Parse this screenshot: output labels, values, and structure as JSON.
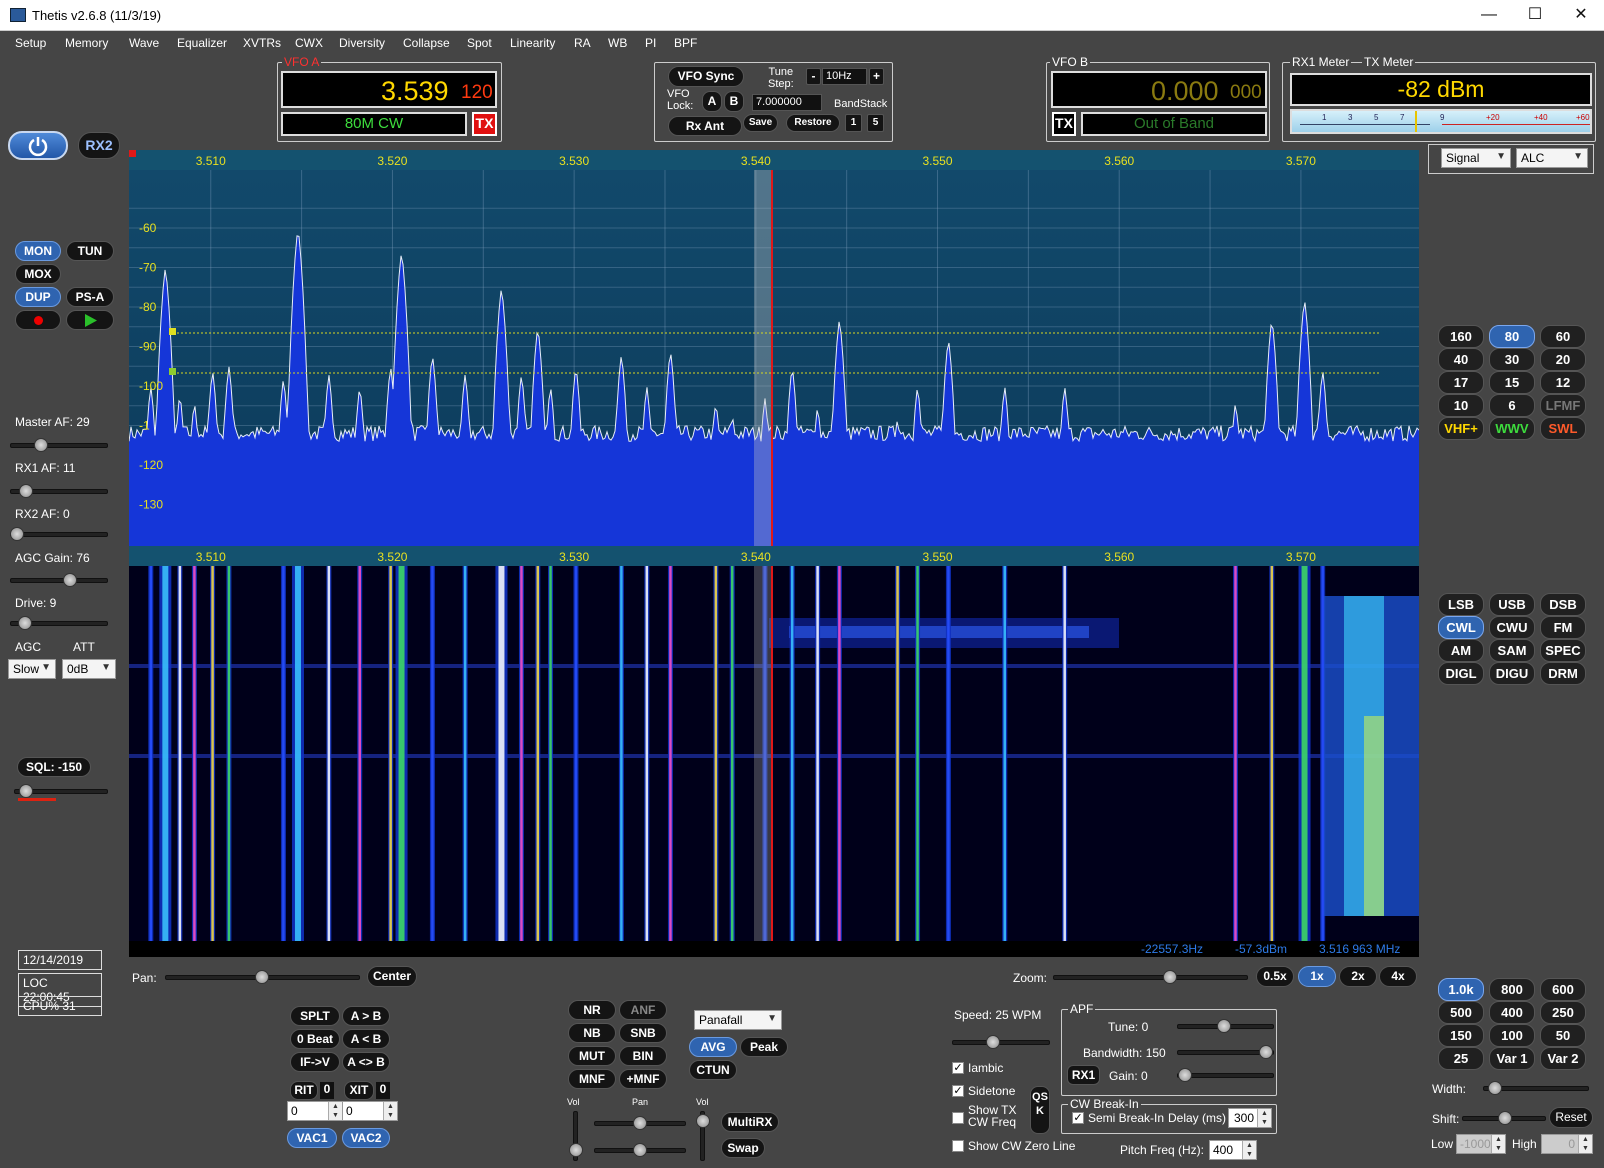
{
  "window": {
    "title": "Thetis v2.6.8 (11/3/19)",
    "min": "—",
    "max": "☐",
    "close": "✕"
  },
  "menu": [
    "Setup",
    "Memory",
    "Wave",
    "Equalizer",
    "XVTRs",
    "CWX",
    "Diversity",
    "Collapse",
    "Spot",
    "Linearity",
    "RA",
    "WB",
    "PI",
    "BPF"
  ],
  "vfo_a": {
    "caption": "VFO A",
    "freq": "3.539",
    "freq_sub": "120",
    "band_mode": "80M CW",
    "tx": "TX"
  },
  "vfo_center": {
    "sync": "VFO Sync",
    "tune_step_label": "Tune\nStep:",
    "tune_step_value": "10Hz",
    "minus": "-",
    "plus": "+",
    "lock_label": "VFO\nLock:",
    "a": "A",
    "b": "B",
    "bandstack_value": "7.000000",
    "bandstack_label": "BandStack",
    "rx_ant": "Rx Ant",
    "save": "Save",
    "restore": "Restore",
    "one": "1",
    "five": "5"
  },
  "vfo_b": {
    "caption": "VFO B",
    "freq": "0.000",
    "freq_sub": "000",
    "tx": "TX",
    "band_label": "Out of Band"
  },
  "meter": {
    "rx1_label": "RX1 Meter",
    "tx_label": "TX Meter",
    "reading": "-82 dBm",
    "scale": [
      "1",
      "3",
      "5",
      "7",
      "9",
      "+20",
      "+40",
      "+60"
    ],
    "rx_mode": "Signal",
    "tx_mode": "ALC"
  },
  "left": {
    "power_icon": "power-icon",
    "rx2": "RX2",
    "mon": "MON",
    "tun": "TUN",
    "mox": "MOX",
    "dup": "DUP",
    "psa": "PS-A",
    "master_af": "Master AF:  29",
    "rx1_af": "RX1 AF:  11",
    "rx2_af": "RX2 AF:  0",
    "agc_gain": "AGC Gain:  76",
    "drive": "Drive:  9",
    "agc_label": "AGC",
    "att_label": "ATT",
    "agc_value": "Slow",
    "att_value": "0dB",
    "sql": "SQL: -150",
    "date": "12/14/2019",
    "loc": "LOC 22:00:45",
    "cpu": "CPU%  31"
  },
  "levels": {
    "master_af": 29,
    "rx1_af": 11,
    "rx2_af": 0,
    "agc_gain": 76,
    "drive": 9,
    "sql": -150
  },
  "panadapter": {
    "freq_ticks": [
      "3.510",
      "3.520",
      "3.530",
      "3.540",
      "3.550",
      "3.560",
      "3.570"
    ],
    "db_ticks": [
      "-60",
      "-70",
      "-80",
      "-90",
      "-100",
      "-1",
      "-120",
      "-130"
    ],
    "readout_offset": "-22557.3Hz",
    "readout_dbm": "-57.3dBm",
    "readout_freq": "3.516 963 MHz"
  },
  "pan_zoom": {
    "pan_label": "Pan:",
    "center": "Center",
    "zoom_label": "Zoom:",
    "z05": "0.5x",
    "z1": "1x",
    "z2": "2x",
    "z4": "4x"
  },
  "bands": [
    "160",
    "80",
    "60",
    "40",
    "30",
    "20",
    "17",
    "15",
    "12",
    "10",
    "6",
    "LFMF",
    "VHF+",
    "WWV",
    "SWL"
  ],
  "modes": [
    "LSB",
    "USB",
    "DSB",
    "CWL",
    "CWU",
    "FM",
    "AM",
    "SAM",
    "SPEC",
    "DIGL",
    "DIGU",
    "DRM"
  ],
  "filters": [
    "1.0k",
    "800",
    "600",
    "500",
    "400",
    "250",
    "150",
    "100",
    "50",
    "25",
    "Var 1",
    "Var 2"
  ],
  "filter_ctrl": {
    "width": "Width:",
    "shift": "Shift:",
    "reset": "Reset",
    "low": "Low",
    "low_val": "-1000",
    "high": "High",
    "high_val": "0"
  },
  "vfo_ops": {
    "splt": "SPLT",
    "atob": "A > B",
    "zbeat": "0 Beat",
    "btoa": "A < B",
    "ifv": "IF->V",
    "swap": "A <> B",
    "rit": "RIT",
    "rit_val": "0",
    "xit": "XIT",
    "xit_val": "0",
    "rit_spin": "0",
    "xit_spin": "0",
    "vac1": "VAC1",
    "vac2": "VAC2"
  },
  "dsp": {
    "nr": "NR",
    "anf": "ANF",
    "nb": "NB",
    "snb": "SNB",
    "mut": "MUT",
    "bin": "BIN",
    "mnf": "MNF",
    "pmnf": "+MNF",
    "display": "Panafall",
    "avg": "AVG",
    "peak": "Peak",
    "ctun": "CTUN",
    "vol": "Vol",
    "pan": "Pan",
    "vol2": "Vol",
    "multirx": "MultiRX",
    "swap": "Swap"
  },
  "cw": {
    "speed": "Speed:  25 WPM",
    "iambic": "Iambic",
    "sidetone": "Sidetone",
    "show_tx": "Show TX\nCW Freq",
    "show_zero": "Show CW Zero Line",
    "qsk": "QSK",
    "apf": "APF",
    "tune": "Tune:  0",
    "bandwidth": "Bandwidth:  150",
    "rx1": "RX1",
    "gain": "Gain:  0",
    "breakin": "CW Break-In",
    "semi": "Semi Break-In",
    "delay": "Delay (ms)",
    "delay_val": "300",
    "pitch": "Pitch Freq (Hz):",
    "pitch_val": "400"
  }
}
